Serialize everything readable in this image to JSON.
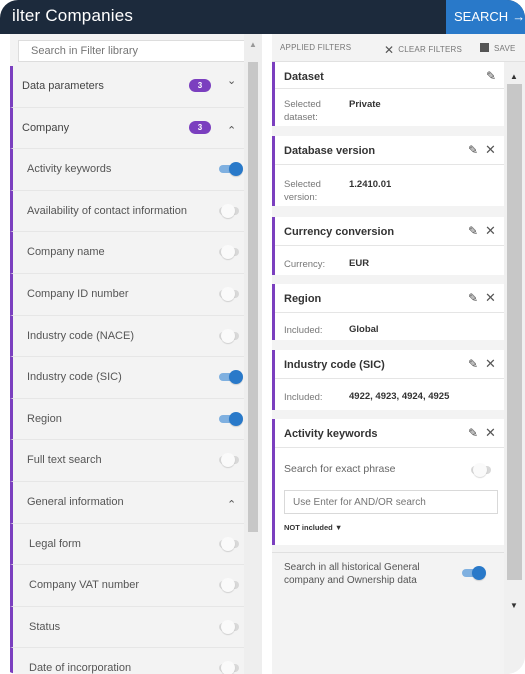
{
  "header": {
    "title": "ilter Companies",
    "search_label": "SEARCH",
    "search_arrow": "→"
  },
  "left": {
    "search_placeholder": "Search in Filter library",
    "items": [
      {
        "label": "Data parameters",
        "type": "section",
        "badge": "3",
        "chevron": "⌄"
      },
      {
        "label": "Company",
        "type": "section",
        "badge": "3",
        "chevron": "⌃"
      },
      {
        "label": "Activity keywords",
        "type": "sub",
        "toggle": "on"
      },
      {
        "label": "Availability of contact information",
        "type": "sub",
        "toggle": "off"
      },
      {
        "label": "Company name",
        "type": "sub",
        "toggle": "off"
      },
      {
        "label": "Company ID number",
        "type": "sub",
        "toggle": "off"
      },
      {
        "label": "Industry code (NACE)",
        "type": "sub",
        "toggle": "off"
      },
      {
        "label": "Industry code (SIC)",
        "type": "sub",
        "toggle": "on"
      },
      {
        "label": "Region",
        "type": "sub",
        "toggle": "on"
      },
      {
        "label": "Full text search",
        "type": "sub",
        "toggle": "off"
      },
      {
        "label": "General information",
        "type": "group",
        "chevron": "⌃"
      },
      {
        "label": "Legal form",
        "type": "sub2",
        "toggle": "off"
      },
      {
        "label": "Company VAT number",
        "type": "sub2",
        "toggle": "off"
      },
      {
        "label": "Status",
        "type": "sub2",
        "toggle": "off"
      },
      {
        "label": "Date of incorporation",
        "type": "sub2",
        "toggle": "off"
      }
    ]
  },
  "right": {
    "toolbar": {
      "applied": "APPLIED FILTERS",
      "clear": "CLEAR FILTERS",
      "save": "SAVE"
    },
    "cards": {
      "dataset": {
        "title": "Dataset",
        "key": "Selected dataset:",
        "value": "Private"
      },
      "dbversion": {
        "title": "Database version",
        "key": "Selected version:",
        "value": "1.2410.01"
      },
      "currency": {
        "title": "Currency conversion",
        "key": "Currency:",
        "value": "EUR"
      },
      "region": {
        "title": "Region",
        "key": "Included:",
        "value": "Global"
      },
      "sic": {
        "title": "Industry code (SIC)",
        "key": "Included:",
        "value": "4922, 4923, 4924, 4925"
      },
      "activity": {
        "title": "Activity keywords",
        "exact_phrase": "Search for exact phrase",
        "input_placeholder": "Use Enter for AND/OR search",
        "not_included": "NOT included"
      }
    },
    "historical": "Search in all historical General company and Ownership data",
    "icons": {
      "pen": "✎",
      "close": "✕",
      "caret_down": "▼"
    }
  },
  "colors": {
    "header_bg": "#1c2a3c",
    "accent_blue": "#2979c9",
    "accent_purple": "#7b3fbf"
  }
}
